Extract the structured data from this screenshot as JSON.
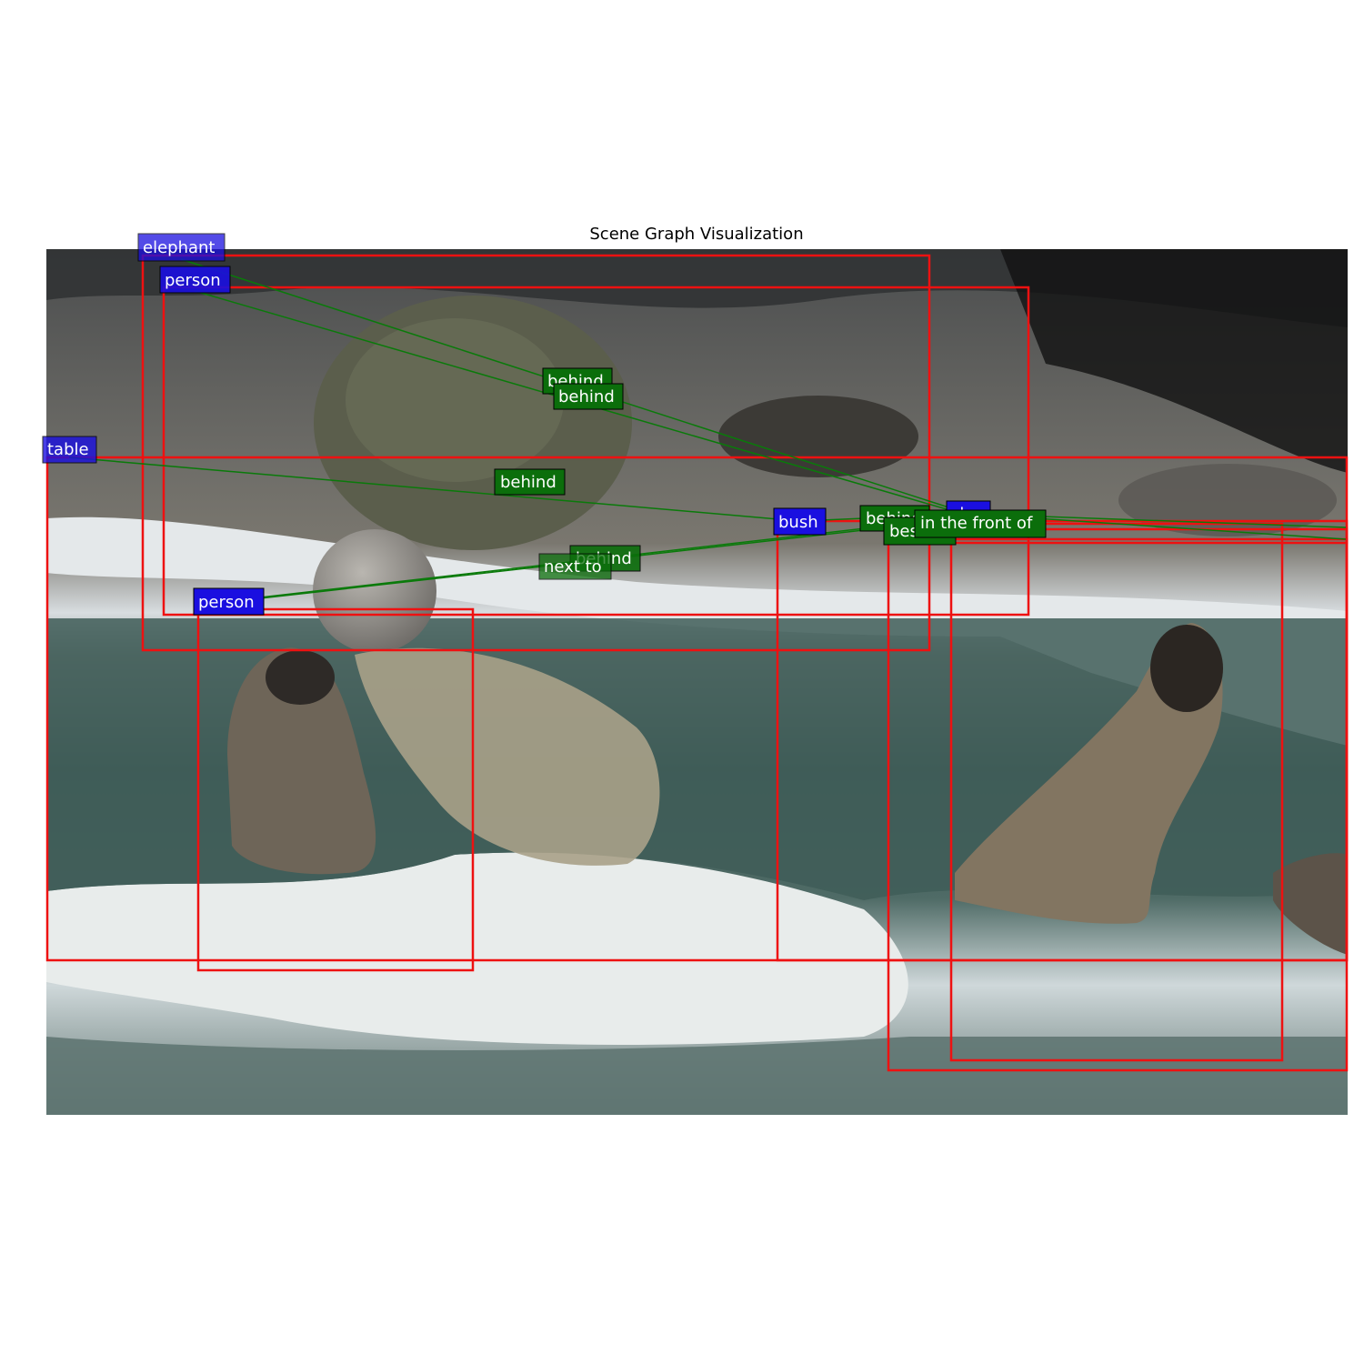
{
  "title": "Scene Graph Visualization",
  "colors": {
    "box": "#ee1111",
    "object_label_bg": "#1a0fe0",
    "relation_label_bg": "#0b6e0b",
    "edge": "#0a7a0a",
    "label_text": "#ffffff"
  },
  "photo": {
    "description_icons": [
      "rock-boulder",
      "ball",
      "polar-bear-head",
      "polar-bear-paw",
      "snow-ice-floe",
      "water"
    ]
  },
  "objects": [
    {
      "id": "o1",
      "label": "elephant"
    },
    {
      "id": "o2",
      "label": "person"
    },
    {
      "id": "o3",
      "label": "table"
    },
    {
      "id": "o4",
      "label": "person"
    },
    {
      "id": "o5",
      "label": "bush"
    },
    {
      "id": "o6",
      "label": "sky"
    },
    {
      "id": "o7",
      "label": ""
    },
    {
      "id": "o8",
      "label": ""
    }
  ],
  "relations": [
    {
      "label": "behind",
      "subject": "o1",
      "object": "o6"
    },
    {
      "label": "behind",
      "subject": "o2",
      "object": "o6"
    },
    {
      "label": "behind",
      "subject": "o3",
      "object": "o5"
    },
    {
      "label": "behind",
      "subject": "o5",
      "object": "o6"
    },
    {
      "label": "behind",
      "subject": "o4",
      "object": "o6"
    },
    {
      "label": "next to",
      "subject": "o4",
      "object": "o6"
    },
    {
      "label": "beside",
      "subject": "o6",
      "object": "o8"
    },
    {
      "label": "in the front of",
      "subject": "o6",
      "object": "o7"
    }
  ]
}
